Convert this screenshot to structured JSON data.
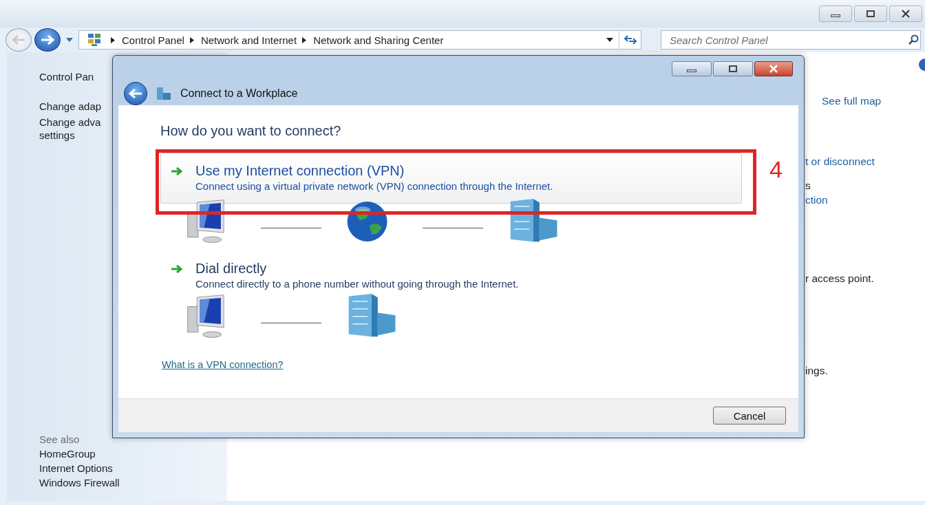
{
  "address_bar": {
    "breadcrumbs": [
      "Control Panel",
      "Network and Internet",
      "Network and Sharing Center"
    ]
  },
  "search": {
    "placeholder": "Search Control Panel"
  },
  "sidebar": {
    "items": [
      "Control Pan",
      "Change adap",
      "Change adva\nsettings"
    ],
    "see_also": {
      "heading": "See also",
      "items": [
        "HomeGroup",
        "Internet Options",
        "Windows Firewall"
      ]
    }
  },
  "main_fragments": [
    {
      "text": "See full map",
      "kind": "link"
    },
    {
      "text": "t or disconnect",
      "kind": "link"
    },
    {
      "text": "s",
      "kind": "text"
    },
    {
      "text": "ction",
      "kind": "link"
    },
    {
      "text": "r access point.",
      "kind": "text"
    },
    {
      "text": "ings.",
      "kind": "text"
    }
  ],
  "dialog": {
    "title": "Connect to a Workplace",
    "heading": "How do you want to connect?",
    "options": [
      {
        "title": "Use my Internet connection (VPN)",
        "description": "Connect using a virtual private network (VPN) connection through the Internet.",
        "highlighted": true,
        "diagram": [
          {
            "kind": "computer"
          },
          {
            "kind": "globe"
          },
          {
            "kind": "building"
          }
        ]
      },
      {
        "title": "Dial directly",
        "description": "Connect directly to a phone number without going through the Internet.",
        "highlighted": false,
        "diagram": [
          {
            "kind": "computer"
          },
          {
            "kind": "building"
          }
        ]
      }
    ],
    "link": "What is a VPN connection?",
    "cancel": "Cancel",
    "annotation": {
      "label": "4"
    }
  }
}
